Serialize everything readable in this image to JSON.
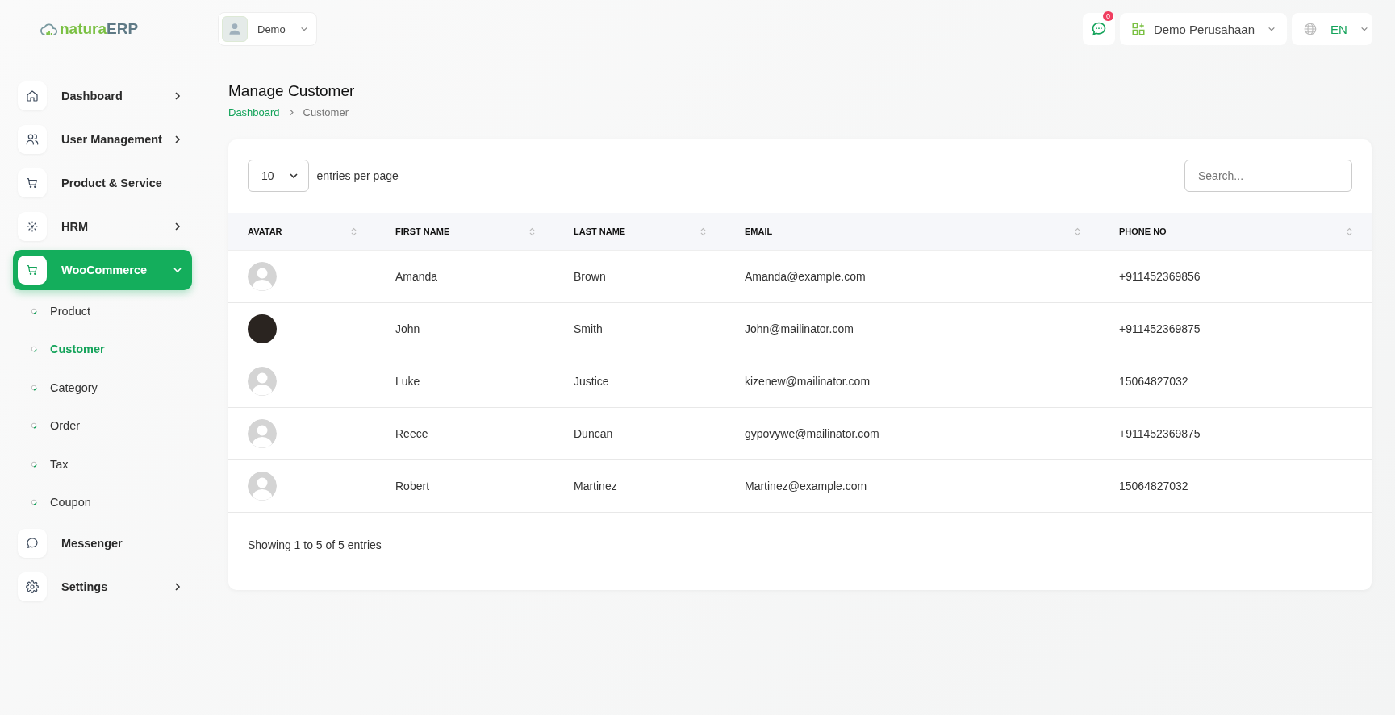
{
  "header": {
    "logo": {
      "part_1": "natura",
      "part_2": "ERP"
    },
    "user": {
      "name": "Demo"
    },
    "notifications": {
      "count": "0"
    },
    "company": {
      "name": "Demo Perusahaan"
    },
    "language": {
      "code": "EN"
    }
  },
  "sidebar": {
    "items": [
      {
        "label": "Dashboard",
        "expandable": true,
        "expanded": false,
        "selected": false
      },
      {
        "label": "User Management",
        "expandable": true,
        "expanded": false,
        "selected": false
      },
      {
        "label": "Product & Service",
        "expandable": false,
        "selected": false
      },
      {
        "label": "HRM",
        "expandable": true,
        "expanded": false,
        "selected": false
      },
      {
        "label": "WooCommerce",
        "expandable": true,
        "expanded": true,
        "selected": true,
        "children": [
          {
            "label": "Product",
            "selected": false
          },
          {
            "label": "Customer",
            "selected": true
          },
          {
            "label": "Category",
            "selected": false
          },
          {
            "label": "Order",
            "selected": false
          },
          {
            "label": "Tax",
            "selected": false
          },
          {
            "label": "Coupon",
            "selected": false
          }
        ]
      },
      {
        "label": "Messenger",
        "expandable": false,
        "selected": false
      },
      {
        "label": "Settings",
        "expandable": true,
        "expanded": false,
        "selected": false
      }
    ]
  },
  "page": {
    "title": "Manage Customer",
    "breadcrumb": [
      "Dashboard",
      "Customer"
    ]
  },
  "table": {
    "page_size": "10",
    "page_size_label": "entries per page",
    "search": {
      "placeholder": "Search..."
    },
    "columns": [
      "AVATAR",
      "FIRST NAME",
      "LAST NAME",
      "EMAIL",
      "PHONE NO"
    ],
    "rows": [
      {
        "has_photo": false,
        "first_name": "Amanda",
        "last_name": "Brown",
        "email": "Amanda@example.com",
        "phone": "+911452369856"
      },
      {
        "has_photo": true,
        "first_name": "John",
        "last_name": "Smith",
        "email": "John@mailinator.com",
        "phone": "+911452369875"
      },
      {
        "has_photo": false,
        "first_name": "Luke",
        "last_name": "Justice",
        "email": "kizenew@mailinator.com",
        "phone": "15064827032"
      },
      {
        "has_photo": false,
        "first_name": "Reece",
        "last_name": "Duncan",
        "email": "gypovywe@mailinator.com",
        "phone": "+911452369875"
      },
      {
        "has_photo": false,
        "first_name": "Robert",
        "last_name": "Martinez",
        "email": "Martinez@example.com",
        "phone": "15064827032"
      }
    ],
    "footer": "Showing 1 to 5 of 5 entries"
  }
}
